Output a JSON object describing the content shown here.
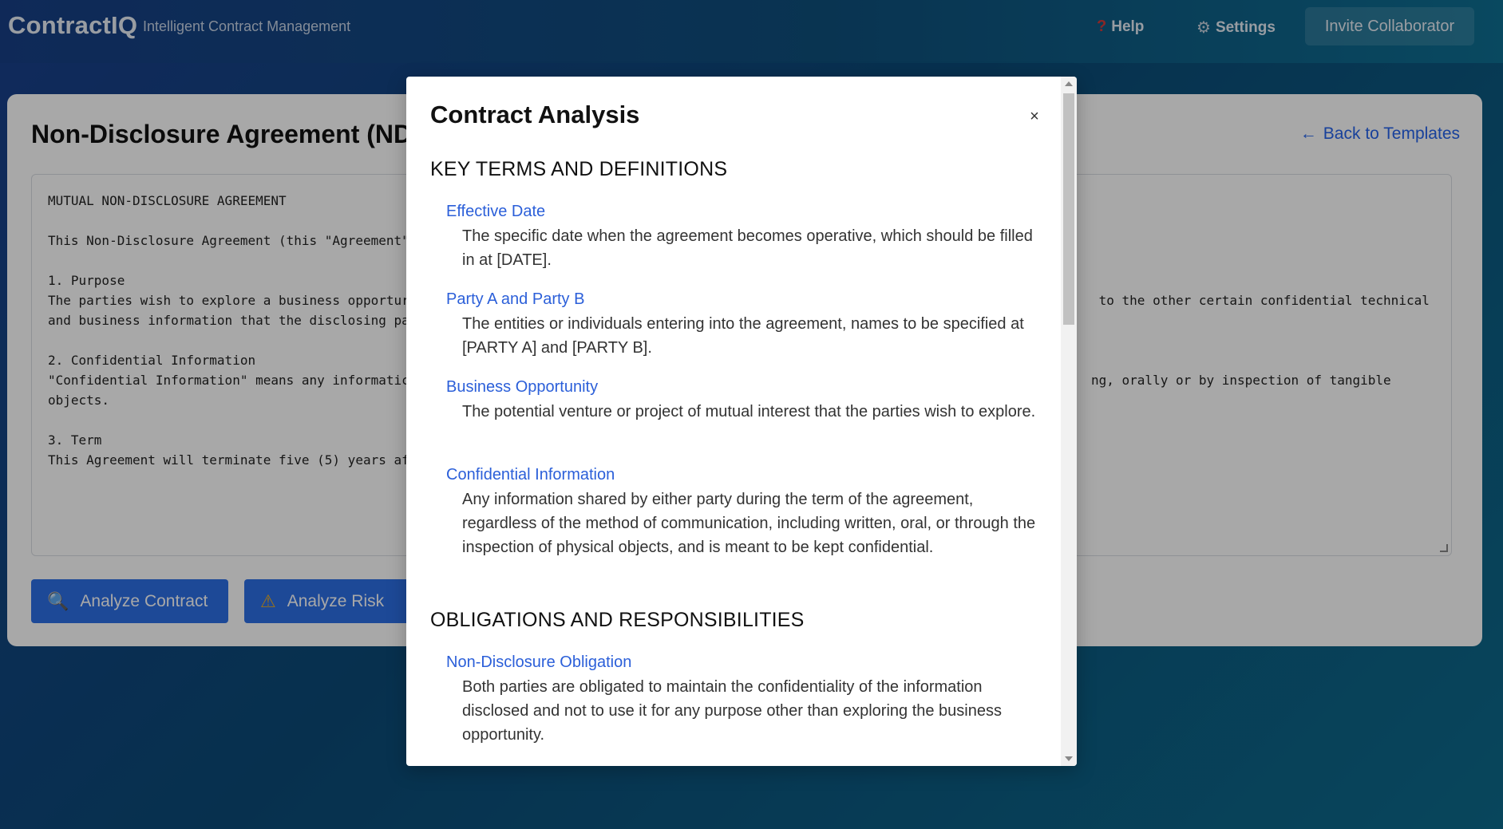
{
  "header": {
    "brand": "ContractIQ",
    "tagline": "Intelligent Contract Management",
    "help_icon": "question-icon",
    "help_label": "Help",
    "settings_icon": "gear-icon",
    "settings_label": "Settings",
    "invite_label": "Invite Collaborator"
  },
  "card": {
    "title": "Non-Disclosure Agreement (NDA)",
    "back_label": "Back to Templates",
    "back_icon": "arrow-left-icon",
    "contract_lines": [
      "MUTUAL NON-DISCLOSURE AGREEMENT",
      "",
      "This Non-Disclosure Agreement (this \"Agreement\"",
      "",
      "1. Purpose",
      "The parties wish to explore a business opportur",
      "and business information that the disclosing pa",
      "",
      "2. Confidential Information",
      "\"Confidential Information\" means any informatic",
      "objects.",
      "",
      "3. Term",
      "This Agreement will terminate five (5) years af"
    ],
    "contract_right_lines": [
      "",
      "",
      "",
      "",
      "",
      " to the other certain confidential technical",
      "",
      "",
      "",
      "ng, orally or by inspection of tangible",
      "",
      "",
      "",
      ""
    ],
    "analyze_label": "Analyze Contract",
    "analyze_icon": "magnifier-icon",
    "risk_label": "Analyze Risk",
    "risk_icon": "warning-icon"
  },
  "modal": {
    "title": "Contract Analysis",
    "close_label": "×",
    "sections": [
      {
        "heading": "KEY TERMS AND DEFINITIONS",
        "items": [
          {
            "term": "Effective Date",
            "desc": "The specific date when the agreement becomes operative, which should be filled in at [DATE]."
          },
          {
            "term": "Party A and Party B",
            "desc": "The entities or individuals entering into the agreement, names to be specified at [PARTY A] and [PARTY B]."
          },
          {
            "term": "Business Opportunity",
            "desc": "The potential venture or project of mutual interest that the parties wish to explore."
          },
          {
            "term": "Confidential Information",
            "desc": "Any information shared by either party during the term of the agreement, regardless of the method of communication, including written, oral, or through the inspection of physical objects, and is meant to be kept confidential."
          }
        ]
      },
      {
        "heading": "OBLIGATIONS AND RESPONSIBILITIES",
        "items": [
          {
            "term": "Non-Disclosure Obligation",
            "desc": "Both parties are obligated to maintain the confidentiality of the information disclosed and not to use it for any purpose other than exploring the business opportunity."
          }
        ]
      }
    ]
  }
}
